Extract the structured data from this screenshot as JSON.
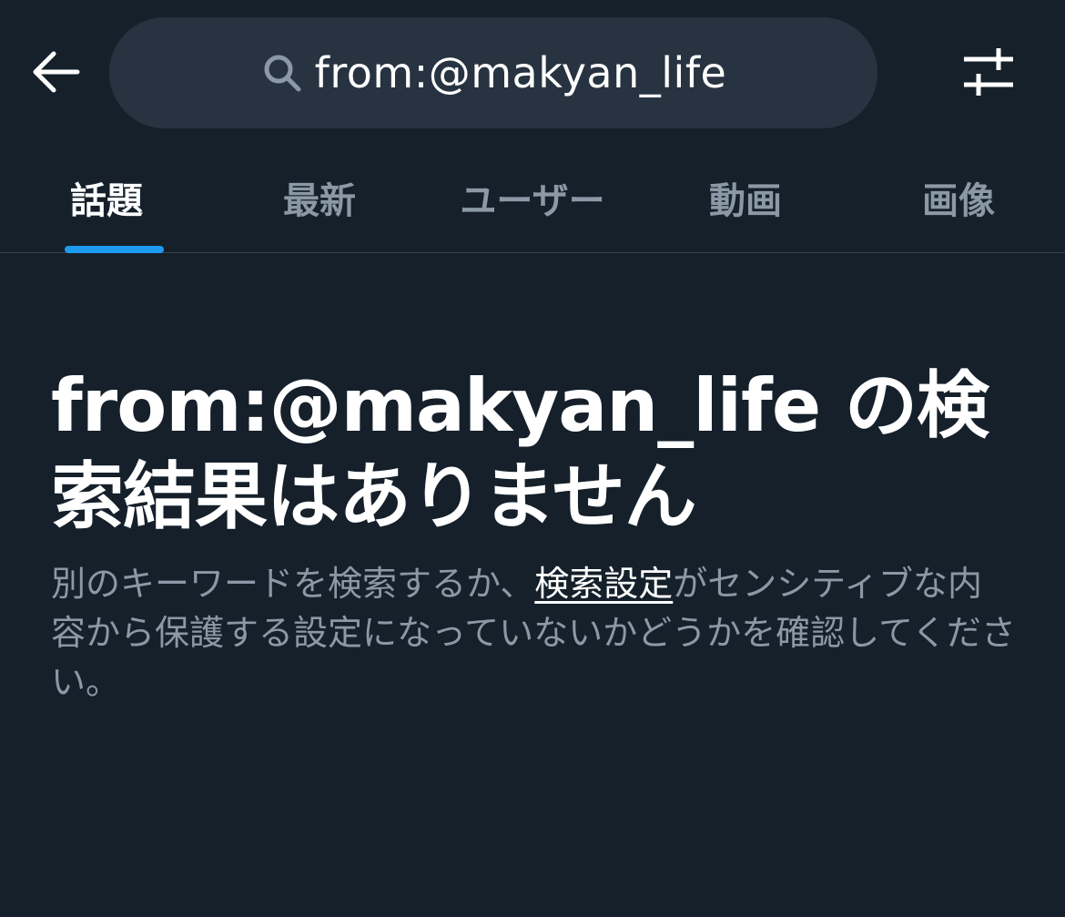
{
  "colors": {
    "background": "#15202b",
    "search_bg": "#273340",
    "accent": "#1d9bf0",
    "secondary_text": "#8b98a5",
    "divider": "#38444d"
  },
  "header": {
    "back_icon": "arrow-left-icon",
    "search": {
      "icon": "search-icon",
      "query": "from:@makyan_life"
    },
    "filter_icon": "sliders-icon"
  },
  "tabs": [
    {
      "label": "話題",
      "active": true
    },
    {
      "label": "最新",
      "active": false
    },
    {
      "label": "ユーザー",
      "active": false
    },
    {
      "label": "動画",
      "active": false
    },
    {
      "label": "画像",
      "active": false
    }
  ],
  "empty_state": {
    "title": "from:@makyan_life の検索結果はありません",
    "description_before": "別のキーワードを検索するか、",
    "link_label": "検索設定",
    "description_after": "がセンシティブな内容から保護する設定になっていないかどうかを確認してください。"
  }
}
